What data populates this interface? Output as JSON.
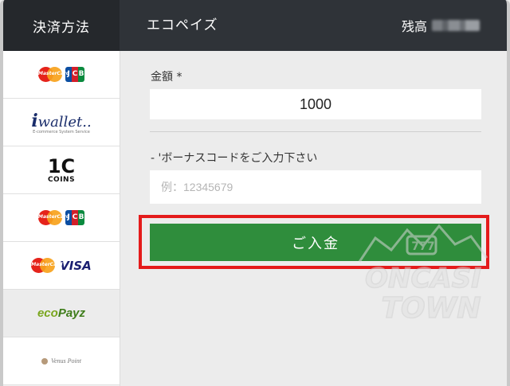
{
  "header": {
    "left_label": "決済方法",
    "title": "エコペイズ",
    "balance_label": "残高"
  },
  "sidebar": {
    "items": [
      {
        "icon": "mastercard-jcb-icon",
        "label": "MasterCard"
      },
      {
        "icon": "iwallet-icon",
        "label": "wallet",
        "sub": "E-commerce System Service"
      },
      {
        "icon": "coins-icon",
        "label": "COINS"
      },
      {
        "icon": "mastercard-jcb-icon",
        "label": "MasterCard"
      },
      {
        "icon": "mastercard-visa-icon",
        "label": "VISA"
      },
      {
        "icon": "ecopayz-icon",
        "label_a": "eco",
        "label_b": "Payz"
      },
      {
        "icon": "venuspoint-icon",
        "label": "Venus Point"
      }
    ]
  },
  "form": {
    "amount_label": "金額 *",
    "amount_value": "1000",
    "bonus_label": "- 'ボーナスコードをご入力下さい",
    "bonus_placeholder": "例：12345679",
    "deposit_label": "ご入金"
  },
  "watermark": {
    "line1": "ONCASI",
    "line2": "TOWN"
  },
  "colors": {
    "header_bg": "#2f3338",
    "header_left_bg": "#25282c",
    "button_green": "#2f8d3c",
    "highlight_red": "#e41b1b",
    "ecopayz_green": "#7aa61f"
  }
}
